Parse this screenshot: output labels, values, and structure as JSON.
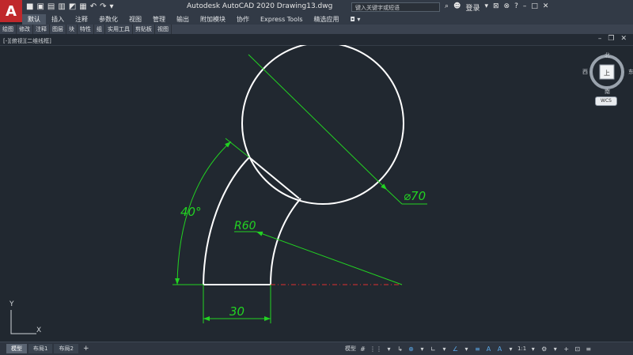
{
  "app": {
    "logo": "A",
    "title": "Autodesk AutoCAD 2020    Drawing13.dwg",
    "search_placeholder": "键入关键字或短语",
    "login": "登录",
    "quick_access_icons": [
      "new-file-icon",
      "open-icon",
      "save-icon",
      "save-as-icon",
      "web-icon",
      "print-icon",
      "undo-icon",
      "redo-icon",
      "dropdown-icon"
    ]
  },
  "ribbon": {
    "tabs": [
      "默认",
      "插入",
      "注释",
      "参数化",
      "视图",
      "管理",
      "输出",
      "附加模块",
      "协作",
      "Express Tools",
      "精选应用"
    ],
    "active_tab": 0,
    "panels": [
      "绘图",
      "修改",
      "注释",
      "图层",
      "块",
      "特性",
      "组",
      "实用工具",
      "剪贴板",
      "视图"
    ]
  },
  "viewport": {
    "label": "[-][俯视][二维线框]"
  },
  "drawing": {
    "dimensions": {
      "diameter": "⌀70",
      "radius": "R60",
      "angle": "40°",
      "linear": "30"
    },
    "colors": {
      "geometry": "#ffffff",
      "dimension": "#22d322",
      "centerline": "#e03030",
      "background": "#212830"
    }
  },
  "viewcube": {
    "north": "北",
    "south": "南",
    "east": "东",
    "west": "西",
    "top_face": "上",
    "wcs": "WCS"
  },
  "ucs": {
    "x": "X",
    "y": "Y"
  },
  "statusbar": {
    "layout_tabs": [
      "模型",
      "布局1",
      "布局2"
    ],
    "add_tab": "+",
    "right": [
      "模型",
      "#",
      "⋮⋮",
      "▾",
      "↳",
      "⊕",
      "▾",
      "∟",
      "▾",
      "∠",
      "▾",
      "≡",
      "A",
      "A",
      "▾",
      "1:1",
      "▾",
      "⚙",
      "▾",
      "+",
      "⊡",
      "≡"
    ]
  }
}
